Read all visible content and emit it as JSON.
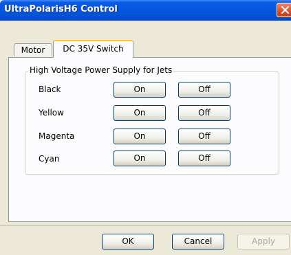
{
  "window": {
    "title": "UltraPolarisH6 Control"
  },
  "tabs": [
    {
      "label": "Motor",
      "selected": false
    },
    {
      "label": "DC 35V Switch",
      "selected": true
    }
  ],
  "group": {
    "label": "High Voltage  Power Supply for Jets",
    "rows": [
      {
        "label": "Black",
        "on_label": "On",
        "off_label": "Off"
      },
      {
        "label": "Yellow",
        "on_label": "On",
        "off_label": "Off"
      },
      {
        "label": "Magenta",
        "on_label": "On",
        "off_label": "Off"
      },
      {
        "label": "Cyan",
        "on_label": "On",
        "off_label": "Off"
      }
    ]
  },
  "buttons": {
    "ok": "OK",
    "cancel": "Cancel",
    "apply": "Apply",
    "apply_disabled": true
  },
  "icons": {
    "close": "close-icon"
  },
  "colors": {
    "titlebar": "#0556e0",
    "close_button": "#e0502c",
    "dialog_bg": "#ece9d8",
    "panel_bg": "#fcfcfe"
  }
}
